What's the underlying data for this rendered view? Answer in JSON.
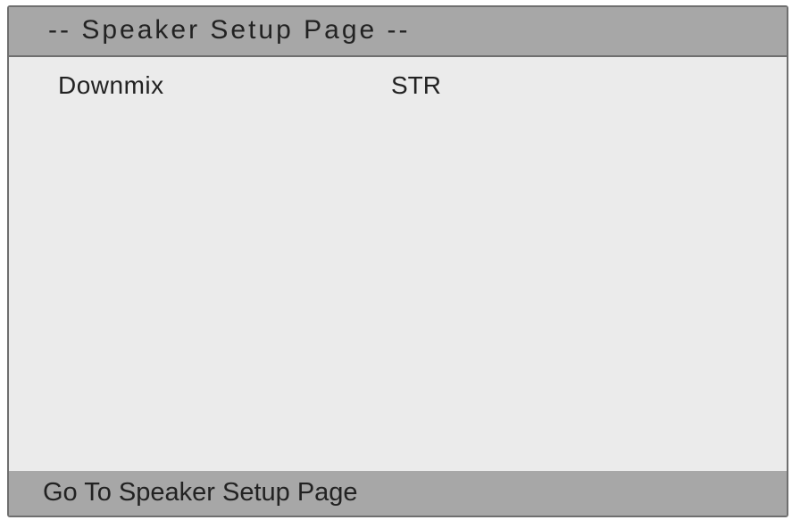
{
  "header": {
    "title": "-- Speaker Setup Page --"
  },
  "menu": {
    "items": [
      {
        "label": "Downmix",
        "value": "STR"
      }
    ]
  },
  "footer": {
    "status": "Go To Speaker Setup Page"
  },
  "colors": {
    "bar": "#a7a7a7",
    "panel": "#ebebeb",
    "border": "#6f6f6f",
    "text": "#222222"
  }
}
